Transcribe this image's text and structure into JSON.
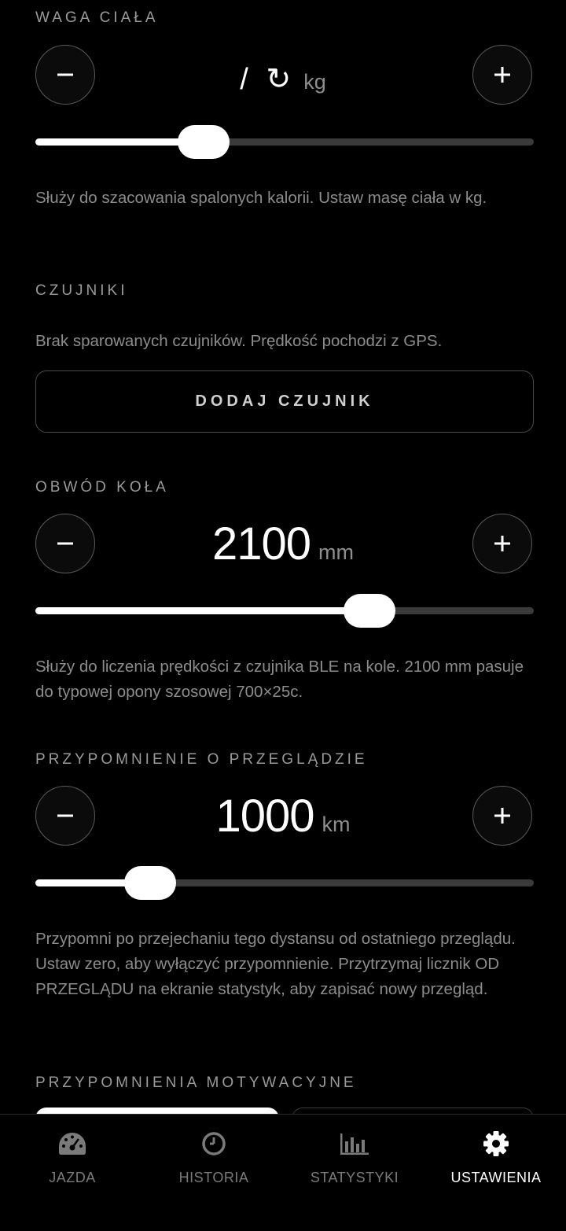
{
  "weight": {
    "title": "WAGA CIAŁA",
    "value": "/ ↻",
    "unit": "kg",
    "slider_fraction": 0.337,
    "description": "Służy do szacowania spalonych kalorii. Ustaw masę ciała w kg."
  },
  "sensors": {
    "title": "CZUJNIKI",
    "description": "Brak sparowanych czujników. Prędkość pochodzi z GPS.",
    "add_button": "DODAJ CZUJNIK"
  },
  "wheel": {
    "title": "OBWÓD KOŁA",
    "value": "2100",
    "unit": "mm",
    "slider_fraction": 0.67,
    "description": "Służy do liczenia prędkości z czujnika BLE na kole. 2100 mm pasuje do typowej opony szosowej 700×25c."
  },
  "service": {
    "title": "PRZYPOMNIENIE O PRZEGLĄDZIE",
    "value": "1000",
    "unit": "km",
    "slider_fraction": 0.23,
    "description": "Przypomni po przejechaniu tego dystansu od ostatniego przeglądu. Ustaw zero, aby wyłączyć przypomnienie. Przytrzymaj licznik OD PRZEGLĄDU na ekranie statystyk, aby zapisać nowy przegląd."
  },
  "motivation": {
    "title": "PRZYPOMNIENIA MOTYWACYJNE"
  },
  "nav": {
    "items": [
      {
        "label": "JAZDA",
        "icon": "speedometer-icon"
      },
      {
        "label": "HISTORIA",
        "icon": "clock-icon"
      },
      {
        "label": "STATYSTYKI",
        "icon": "bar-chart-icon"
      },
      {
        "label": "USTAWIENIA",
        "icon": "gear-icon",
        "active": true
      }
    ]
  },
  "colors": {
    "background": "#000000",
    "accent": "#ffffff",
    "muted_text": "#8c8c8c",
    "track": "#3a3a3a"
  }
}
